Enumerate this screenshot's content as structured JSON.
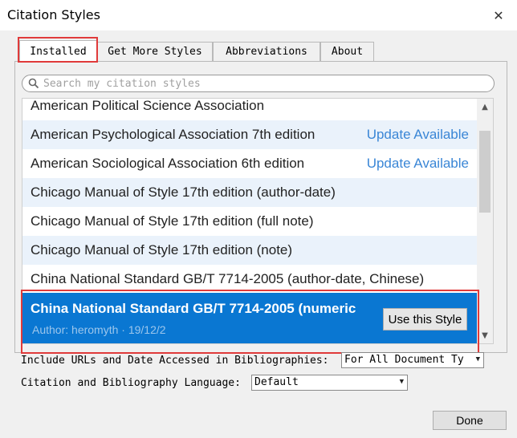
{
  "window": {
    "title": "Citation Styles",
    "close_glyph": "✕"
  },
  "tabs": [
    {
      "label": "Installed",
      "active": true
    },
    {
      "label": "Get More Styles",
      "active": false
    },
    {
      "label": "Abbreviations",
      "active": false
    },
    {
      "label": "About",
      "active": false
    }
  ],
  "search": {
    "placeholder": "Search my citation styles",
    "value": ""
  },
  "styles": [
    {
      "name": "American Political Science Association",
      "status": ""
    },
    {
      "name": "American Psychological Association 7th edition",
      "status": "Update Available"
    },
    {
      "name": "American Sociological Association 6th edition",
      "status": "Update Available"
    },
    {
      "name": "Chicago Manual of Style 17th edition (author-date)",
      "status": ""
    },
    {
      "name": "Chicago Manual of Style 17th edition (full note)",
      "status": ""
    },
    {
      "name": "Chicago Manual of Style 17th edition (note)",
      "status": ""
    },
    {
      "name": "China National Standard GB/T 7714-2005 (author-date, Chinese)",
      "status": ""
    }
  ],
  "selected_style": {
    "name": "China National Standard GB/T 7714-2005 (numeric",
    "author": "Author: heromyth · 19/12/2",
    "action_label": "Use this Style"
  },
  "options": {
    "urls_label": "Include URLs and Date Accessed in Bibliographies:",
    "urls_value": "For All Document Ty",
    "language_label": "Citation and Bibliography Language:",
    "language_value": "Default"
  },
  "footer": {
    "done_label": "Done"
  },
  "colors": {
    "selection": "#0a77d2",
    "update_link": "#3a86d6",
    "highlight_box": "#e03a3a"
  }
}
